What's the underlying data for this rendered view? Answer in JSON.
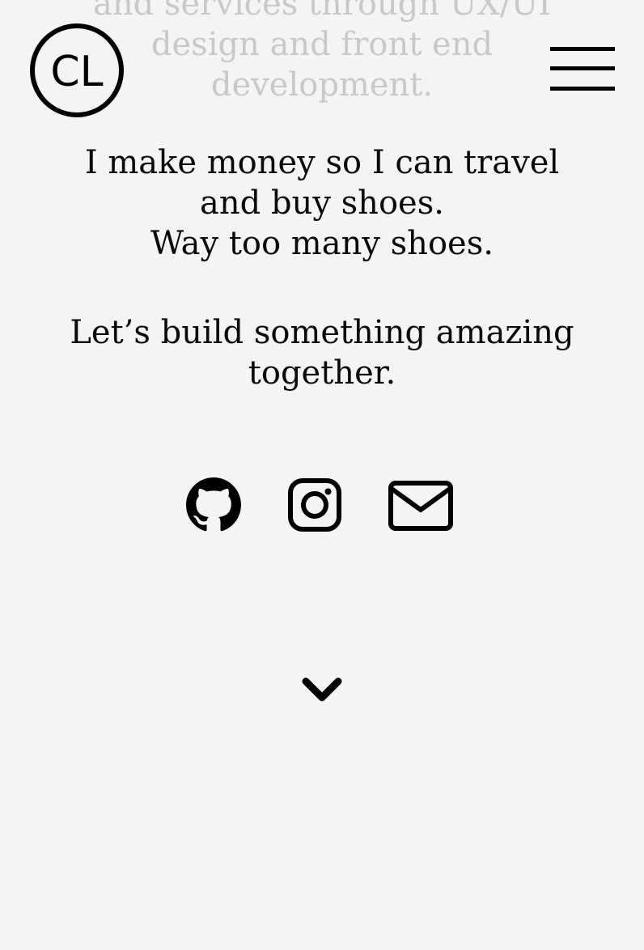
{
  "intro": {
    "lines": [
      "and services through UX/UI",
      "design and front end",
      "development."
    ]
  },
  "header": {
    "logo_text": "CL",
    "menu_icon": "hamburger-icon"
  },
  "tagline": {
    "lines": [
      "I make money so I can travel",
      "and buy shoes.",
      "Way too many shoes."
    ]
  },
  "cta": {
    "lines": [
      "Let’s build something amazing",
      "together."
    ]
  },
  "social": [
    {
      "icon": "github-icon"
    },
    {
      "icon": "instagram-icon"
    },
    {
      "icon": "email-icon"
    }
  ],
  "scroll": {
    "icon": "chevron-down-icon"
  },
  "colors": {
    "background": "#f4f4f4",
    "text": "#0a0a0a",
    "faded_text": "#c8c8c8"
  }
}
